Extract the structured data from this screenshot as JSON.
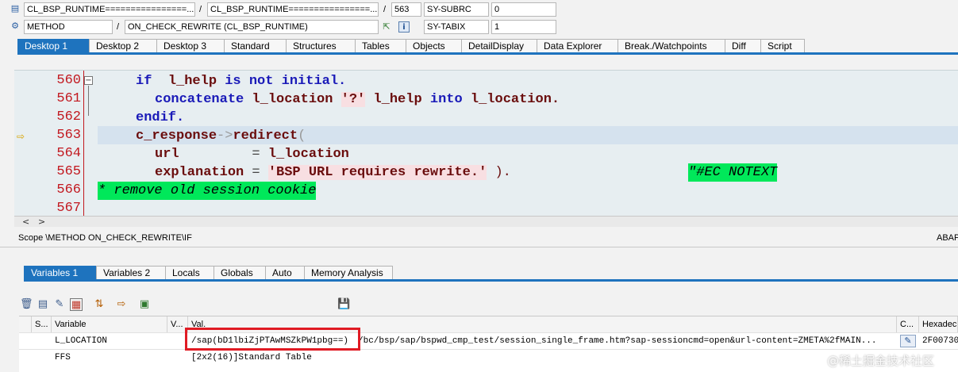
{
  "header": {
    "row1": {
      "program": "CL_BSP_RUNTIME================...",
      "sep1": "/",
      "include": "CL_BSP_RUNTIME================...",
      "sep2": "/",
      "line": "563",
      "sysfield_label": "SY-SUBRC",
      "sysfield_value": "0"
    },
    "row2": {
      "kind": "METHOD",
      "sep": "/",
      "event": "ON_CHECK_REWRITE (CL_BSP_RUNTIME)",
      "sysfield_label": "SY-TABIX",
      "sysfield_value": "1"
    }
  },
  "desktop_tabs": [
    "Desktop 1",
    "Desktop 2",
    "Desktop 3",
    "Standard",
    "Structures",
    "Tables",
    "Objects",
    "DetailDisplay",
    "Data Explorer",
    "Break./Watchpoints",
    "Diff",
    "Script"
  ],
  "editor": {
    "line_numbers": [
      "560",
      "561",
      "562",
      "563",
      "564",
      "565",
      "566",
      "567"
    ],
    "lines": {
      "l560": {
        "kw1": "if",
        "sp1": "  ",
        "id1": "l_help",
        "kw2": " is not initial."
      },
      "l561": {
        "kw1": "concatenate",
        "id1": " l_location ",
        "str1": "'?'",
        "id2": " l_help ",
        "kw2": "into",
        "id3": " l_location."
      },
      "l562": {
        "kw1": "endif."
      },
      "l563": {
        "id1": "c_response",
        "op1": "->",
        "id2": "redirect",
        "op2": "("
      },
      "l564": {
        "id1": "url",
        "op1": "         = ",
        "id2": "l_location"
      },
      "l565": {
        "id1": "explanation",
        "op1": " = ",
        "str1": "'BSP URL requires rewrite.'",
        "op2": " ).",
        "pragma": "\"#EC NOTEXT"
      },
      "l566": {
        "cmt": "* remove old session cookie"
      }
    },
    "scroll_left": "<",
    "scroll_right": ">"
  },
  "scope": {
    "left": "Scope \\METHOD ON_CHECK_REWRITE\\IF",
    "right": "ABAP"
  },
  "variable_tabs": [
    "Variables 1",
    "Variables 2",
    "Locals",
    "Globals",
    "Auto",
    "Memory Analysis"
  ],
  "grid": {
    "columns": {
      "s": "S...",
      "variable": "Variable",
      "v": "V...",
      "val": "Val.",
      "c": "C...",
      "hex": "Hexadec"
    },
    "rows": [
      {
        "variable": "L_LOCATION",
        "val_highlight": "/sap(bD1lbiZjPTAwMSZkPW1pbg==)",
        "val_rest": "/bc/bsp/sap/bspwd_cmp_test/session_single_frame.htm?sap-sessioncmd=open&url-content=ZMETA%2fMAIN...",
        "hex": "2F00730"
      },
      {
        "variable": "FFS",
        "val_highlight": "",
        "val_rest": "[2x2(16)]Standard Table",
        "hex": ""
      }
    ]
  },
  "watermark": "@稀土掘金技术社区",
  "colors": {
    "tab_active": "#1e73be",
    "highlight_box": "#e01b24",
    "comment_bg": "#00e85a",
    "line_number": "#c2181f",
    "keyword": "#1a1ab8"
  }
}
